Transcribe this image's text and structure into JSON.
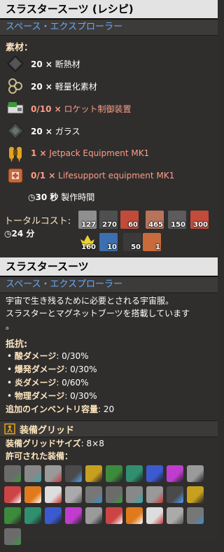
{
  "recipe": {
    "title": "スラスタースーツ (レシピ)",
    "subtitle": "スペース・エクスプローラー",
    "ingredients_label": "素材：",
    "ingredients": [
      {
        "amount": "20 ×",
        "name": "断熱材",
        "icon": "insulation-icon",
        "missing": false
      },
      {
        "amount": "20 ×",
        "name": "軽量化素材",
        "icon": "lightweight-material-icon",
        "missing": false
      },
      {
        "amount": "0/10 ×",
        "name": "ロケット制御装置",
        "icon": "rocket-control-unit-icon",
        "missing": true
      },
      {
        "amount": "20 ×",
        "name": "ガラス",
        "icon": "glass-icon",
        "missing": false
      },
      {
        "amount": "1 ×",
        "name": "Jetpack Equipment MK1",
        "icon": "jetpack-icon",
        "missing": true
      },
      {
        "amount": "0/1 ×",
        "name": "Lifesupport equipment MK1",
        "icon": "lifesupport-icon",
        "missing": true
      }
    ],
    "craft_time": "30 秒",
    "craft_time_label": "製作時間",
    "total_cost_label": "トータルコスト:",
    "total_time": "24 分",
    "total_costs_row1": [
      "127",
      "270",
      "60",
      "465",
      "150",
      "300"
    ],
    "total_costs_row2": [
      "160",
      "10",
      "50",
      "1"
    ]
  },
  "item": {
    "title": "スラスタースーツ",
    "subtitle": "スペース・エクスプローラー",
    "description_lines": [
      "宇宙で生き残るために必要とされる宇宙服。",
      "スラスターとマグネットブーツを搭載しています",
      "。"
    ],
    "resistances_label": "抵抗:",
    "resistances": [
      {
        "name": "酸ダメージ",
        "value": ": 0/30%"
      },
      {
        "name": "爆発ダメージ",
        "value": ": 0/30%"
      },
      {
        "name": "炎ダメージ",
        "value": ": 0/60%"
      },
      {
        "name": "物理ダメージ",
        "value": ": 0/30%"
      }
    ],
    "inventory_bonus_label": "追加のインベントリ容量",
    "inventory_bonus_value": ": 20",
    "equipment_grid_label": "装備グリッド",
    "grid_size_label": "装備グリッドサイズ",
    "grid_size_value": ": 8×8",
    "allowed_label": "許可された装備："
  },
  "colors": {
    "title_bg": "#e3e3e3",
    "subtitle_text": "#66aaff",
    "missing_text": "#ff9c87",
    "heading_text": "#ffe6c0"
  }
}
